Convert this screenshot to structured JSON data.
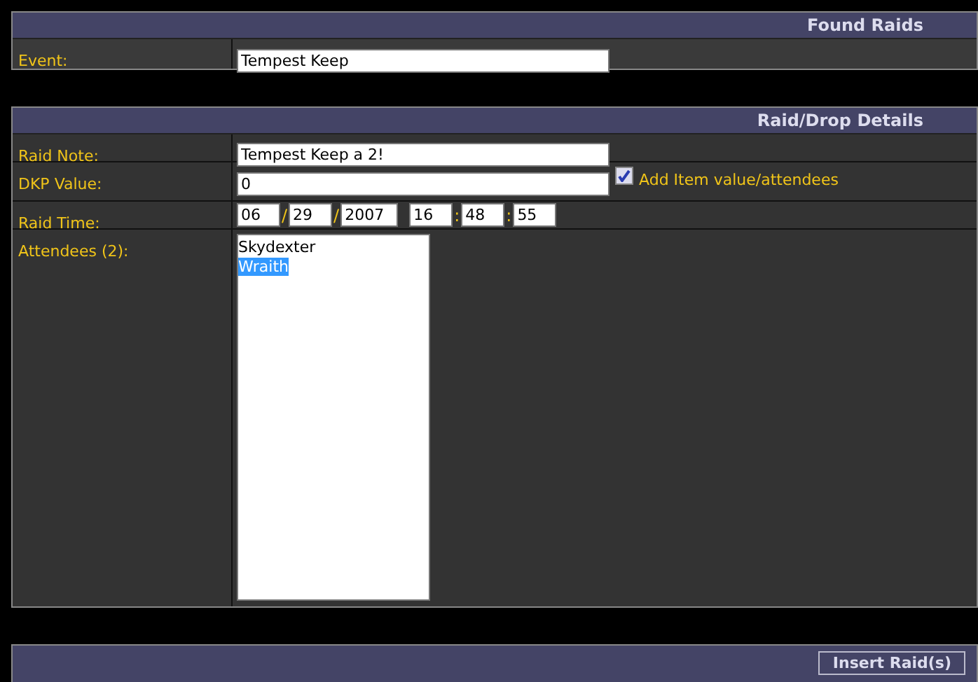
{
  "found_raids": {
    "title": "Found Raids",
    "event": {
      "label": "Event:",
      "value": "Tempest Keep"
    }
  },
  "details": {
    "title": "Raid/Drop Details",
    "raid_note": {
      "label": "Raid Note:",
      "value": "Tempest Keep a 2!"
    },
    "dkp_value": {
      "label": "DKP Value:",
      "value": "0",
      "checkbox": {
        "label": "Add Item value/attendees",
        "checked": true
      }
    },
    "raid_time": {
      "label": "Raid Time:",
      "month": "06",
      "sep1": "/",
      "day": "29",
      "sep2": "/",
      "year": "2007",
      "hour": "16",
      "sep3": ":",
      "minute": "48",
      "sep4": ":",
      "second": "55"
    },
    "attendees": {
      "label": "Attendees (2):",
      "items": [
        {
          "name": "Skydexter",
          "selected": false
        },
        {
          "name": "Wraith",
          "selected": true
        }
      ]
    }
  },
  "footer": {
    "button": "Insert Raid(s)"
  }
}
